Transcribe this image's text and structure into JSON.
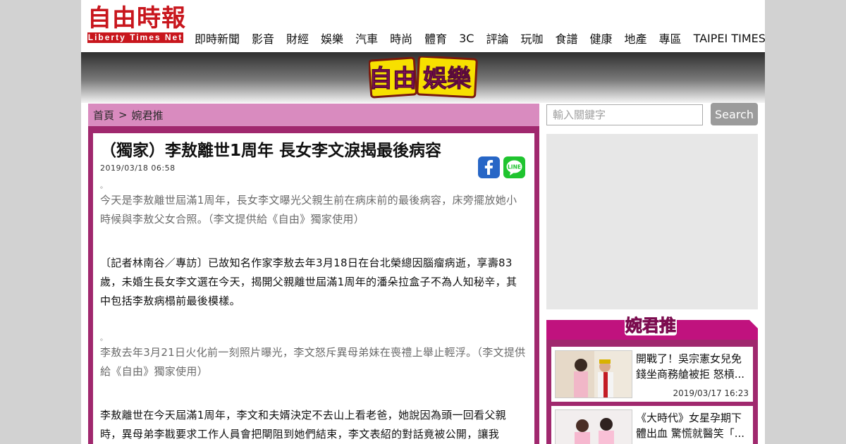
{
  "header": {
    "logo_cn": "自由時報",
    "logo_en": "Liberty Times Net",
    "nav": [
      "即時新聞",
      "影音",
      "財經",
      "娛樂",
      "汽車",
      "時尚",
      "體育",
      "3C",
      "評論",
      "玩咖",
      "食譜",
      "健康",
      "地產",
      "專區",
      "TAIPEI TIMES"
    ]
  },
  "banner": {
    "logo_text": "自由娛樂"
  },
  "breadcrumb": {
    "home": "首頁",
    "sep": ">",
    "section": "婉君推"
  },
  "article": {
    "title": "（獨家）李敖離世1周年 長女李文淚揭最後病容",
    "date": "2019/03/18 06:58",
    "photo_marker": "。",
    "caption1": "今天是李敖離世屆滿1周年，長女李文曝光父親生前在病床前的最後病容，床旁擺放她小時候與李敖父女合照。（李文提供給《自由》獨家使用）",
    "para1": "〔記者林南谷／專訪〕已故知名作家李敖去年3月18日在台北榮總因腦瘤病逝，享壽83歲，未婚生長女李文選在今天，揭開父親離世屆滿1周年的潘朵拉盒子不為人知秘辛，其中包括李敖病榻前最後模樣。",
    "caption2": "李敖去年3月21日火化前一刻照片曝光，李文怒斥異母弟妹在喪禮上舉止輕浮。（李文提供給《自由》獨家使用）",
    "para2": "李敖離世在今天屆滿1周年，李文和夫婿決定不去山上看老爸，她說因為頭一回看父親時，異母弟李戡要求工作人員會把閘阻到她們結束，李文表紹的對話竟被公開，讓我"
  },
  "sidebar": {
    "search_placeholder": "輸入關鍵字",
    "search_button": "Search",
    "rec_logo": "婉君推",
    "items": [
      {
        "line1": "開戰了！吳宗憲女兒免",
        "line2": "錢坐商務艙被拒 怒槓...",
        "date": "2019/03/17 16:23"
      },
      {
        "line1": "《大時代》女星孕期下",
        "line2": "體出血 驚慌就醫笑「...",
        "date": ""
      }
    ]
  },
  "colors": {
    "brand_red": "#c8161d",
    "frame_purple": "#a0286e",
    "crumb_pink": "#d98bbf",
    "rec_magenta": "#c0127e",
    "facebook": "#2766c6",
    "line": "#1fc42f"
  }
}
